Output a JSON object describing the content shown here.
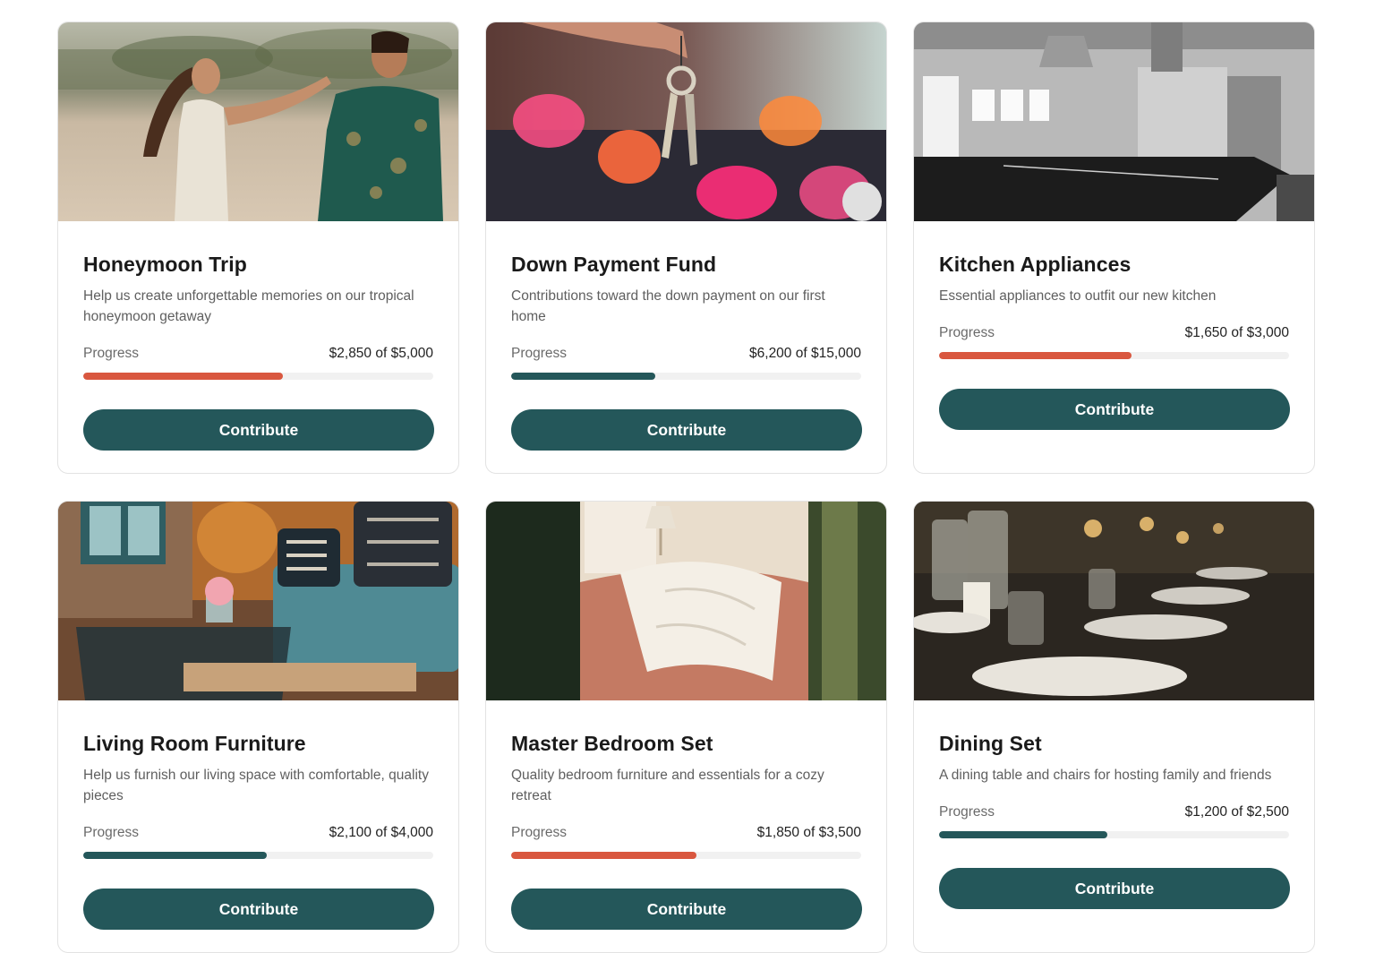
{
  "contribute_label": "Contribute",
  "progress_label": "Progress",
  "colors": {
    "primary": "#24575a",
    "accent": "#d9573f",
    "track": "#f1f1f1"
  },
  "cards": [
    {
      "title": "Honeymoon Trip",
      "description": "Help us create unforgettable memories on our tropical honeymoon getaway",
      "amount": "$2,850 of $5,000",
      "progress": 0.57,
      "bar_color": "accent",
      "image": "couple-on-beach"
    },
    {
      "title": "Down Payment Fund",
      "description": "Contributions toward the down payment on our first home",
      "amount": "$6,200 of $15,000",
      "progress": 0.413,
      "bar_color": "primary",
      "image": "house-keys"
    },
    {
      "title": "Kitchen Appliances",
      "description": "Essential appliances to outfit our new kitchen",
      "amount": "$1,650 of $3,000",
      "progress": 0.55,
      "bar_color": "accent",
      "image": "modern-kitchen"
    },
    {
      "title": "Living Room Furniture",
      "description": "Help us furnish our living space with comfortable, quality pieces",
      "amount": "$2,100 of $4,000",
      "progress": 0.525,
      "bar_color": "primary",
      "image": "living-room-sofa"
    },
    {
      "title": "Master Bedroom Set",
      "description": "Quality bedroom furniture and essentials for a cozy retreat",
      "amount": "$1,850 of $3,500",
      "progress": 0.529,
      "bar_color": "accent",
      "image": "bedroom-bed"
    },
    {
      "title": "Dining Set",
      "description": "A dining table and chairs for hosting family and friends",
      "amount": "$1,200 of $2,500",
      "progress": 0.48,
      "bar_color": "primary",
      "image": "dining-table"
    }
  ]
}
